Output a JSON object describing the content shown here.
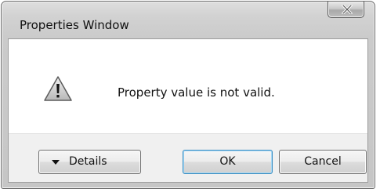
{
  "window": {
    "title": "Properties Window",
    "close_icon": "close-x-icon"
  },
  "dialog": {
    "icon": "warning-icon",
    "message": "Property value is not valid."
  },
  "buttons": {
    "details_icon": "triangle-down-icon",
    "details_label": "Details",
    "ok_label": "OK",
    "cancel_label": "Cancel"
  },
  "colors": {
    "warning_fill": "#d8d8d8",
    "default_button_border": "#3b8ec2"
  }
}
